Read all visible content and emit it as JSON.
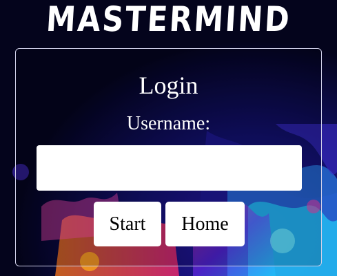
{
  "app": {
    "title": "MASTERMIND"
  },
  "login": {
    "heading": "Login",
    "username_label": "Username:",
    "username_value": "",
    "username_placeholder": ""
  },
  "actions": {
    "start_label": "Start",
    "home_label": "Home"
  },
  "colors": {
    "page_background": "#050522",
    "text": "#ffffff",
    "button_background": "#ffffff",
    "panel_border": "#cfcfe8"
  }
}
